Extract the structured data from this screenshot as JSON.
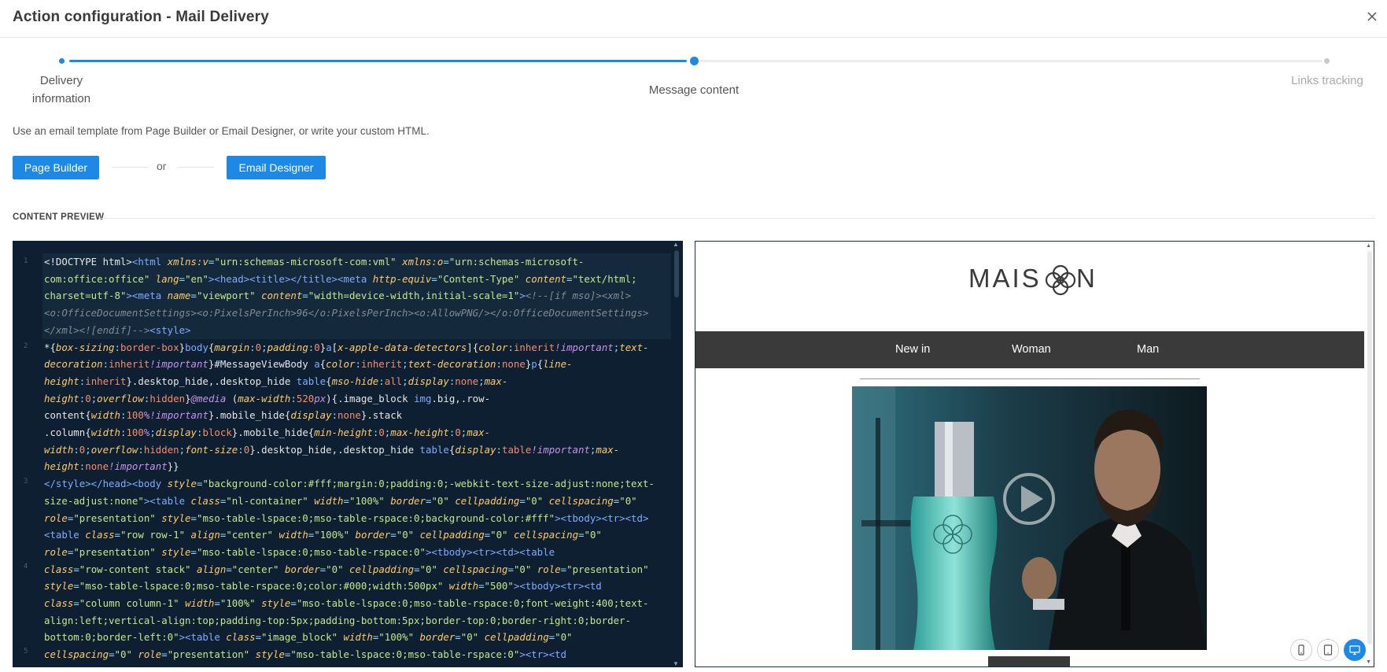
{
  "modal": {
    "title": "Action configuration - Mail Delivery"
  },
  "stepper": {
    "steps": [
      {
        "label": "Delivery information",
        "line1": "Delivery",
        "line2": "information",
        "state": "completed"
      },
      {
        "label": "Message content",
        "state": "current"
      },
      {
        "label": "Links tracking",
        "state": "upcoming"
      }
    ]
  },
  "instruction": "Use an email template from Page Builder or Email Designer, or write your custom HTML.",
  "buttons": {
    "page_builder": "Page Builder",
    "or": "or",
    "email_designer": "Email Designer"
  },
  "section": {
    "content_preview": "CONTENT PREVIEW"
  },
  "editor": {
    "line_numbers": [
      "1",
      "2",
      "3",
      "4",
      "5"
    ]
  },
  "preview": {
    "logo": "MAISON",
    "nav": [
      "New in",
      "Woman",
      "Man"
    ],
    "device_toggles": [
      "mobile-icon",
      "tablet-icon",
      "desktop-icon"
    ],
    "active_device": "desktop"
  },
  "colors": {
    "accent": "#1e88e5",
    "editor_bg": "#0d1f31",
    "nav_bg": "#3a3a3a"
  }
}
